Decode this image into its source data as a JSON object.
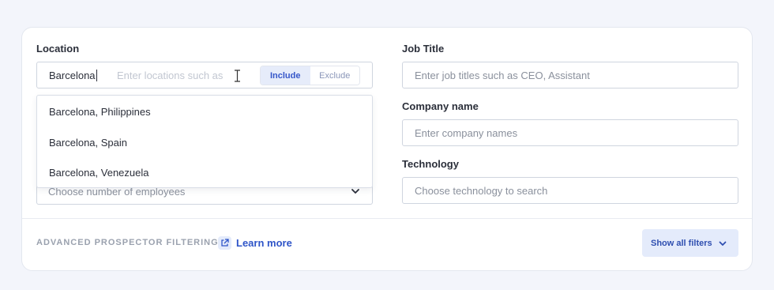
{
  "location": {
    "label": "Location",
    "value": "Barcelona",
    "ghost_text": "Enter locations such as",
    "toggle": {
      "include_label": "Include",
      "exclude_label": "Exclude",
      "selected": "Include"
    },
    "suggestions": [
      "Barcelona, Philippines",
      "Barcelona, Spain",
      "Barcelona, Venezuela"
    ]
  },
  "employees": {
    "placeholder": "Choose number of employees"
  },
  "job_title": {
    "label": "Job Title",
    "placeholder": "Enter job titles such as CEO, Assistant"
  },
  "company_name": {
    "label": "Company name",
    "placeholder": "Enter company names"
  },
  "technology": {
    "label": "Technology",
    "placeholder": "Choose technology to search"
  },
  "footer": {
    "advanced_label": "ADVANCED PROSPECTOR FILTERING",
    "learn_more": "Learn more",
    "show_all_filters": "Show all filters"
  },
  "colors": {
    "accent": "#2f55c8",
    "accent_bg": "#e4ebfb",
    "page_bg": "#f3f5fb"
  },
  "icons": [
    "text-cursor-icon",
    "external-link-icon",
    "chevron-down-icon"
  ]
}
